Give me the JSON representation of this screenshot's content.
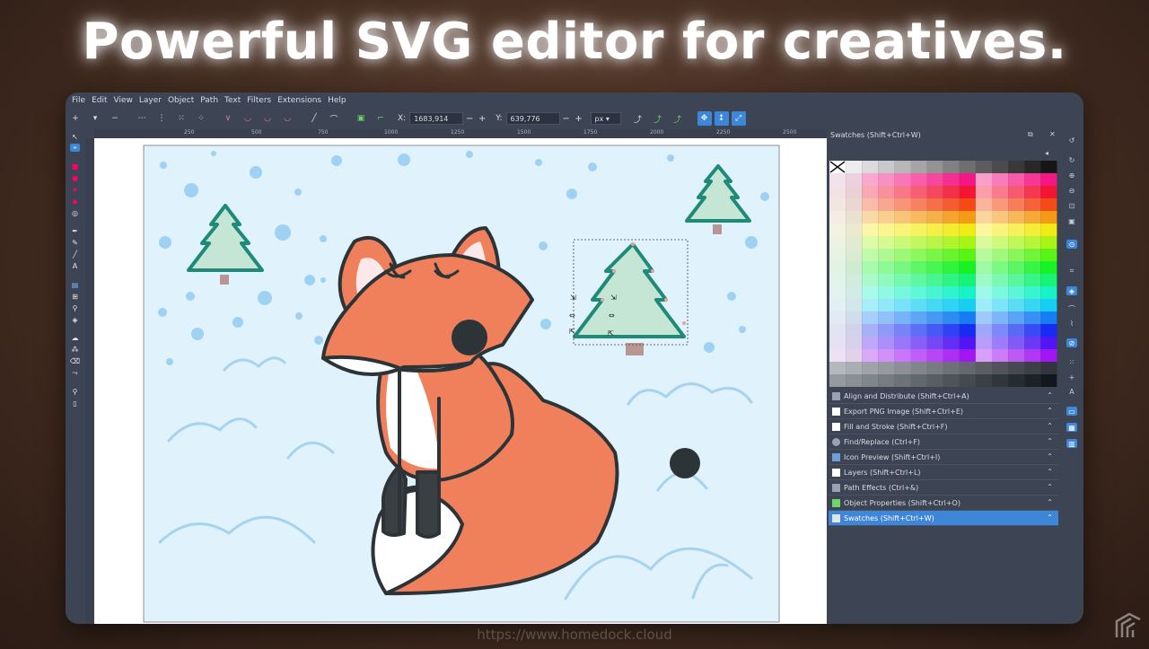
{
  "headline": "Powerful SVG editor for creatives.",
  "footer_url": "https://www.homedock.cloud",
  "colors": {
    "app_bg": "#3d4454",
    "accent": "#3d86d8",
    "canvas_page": "#e0f3fc",
    "fox_orange": "#f07f5c",
    "outline": "#2d3438",
    "tree_fill": "#c5e6d4",
    "tree_stroke": "#1f8a78",
    "snow_dot": "#9fd2f2"
  },
  "menubar": {
    "items": [
      "File",
      "Edit",
      "View",
      "Layer",
      "Object",
      "Path",
      "Text",
      "Filters",
      "Extensions",
      "Help"
    ]
  },
  "toolbar": {
    "x_label": "X:",
    "x_value": "1683,914",
    "y_label": "Y:",
    "y_value": "639,776",
    "minus": "−",
    "plus": "+",
    "unit": "px"
  },
  "ruler": {
    "labels": [
      "250",
      "500",
      "750",
      "1000",
      "1250",
      "1500",
      "1750",
      "2000",
      "2250",
      "2500"
    ]
  },
  "dock": {
    "title": "Swatches (Shift+Ctrl+W)",
    "panels": [
      "Align and Distribute (Shift+Ctrl+A)",
      "Export PNG Image (Shift+Ctrl+E)",
      "Fill and Stroke (Shift+Ctrl+F)",
      "Find/Replace (Ctrl+F)",
      "Icon Preview (Shift+Ctrl+I)",
      "Layers (Shift+Ctrl+L)",
      "Path Effects (Ctrl+&)",
      "Object Properties (Shift+Ctrl+O)",
      "Swatches (Shift+Ctrl+W)"
    ],
    "active_panel": "Swatches (Shift+Ctrl+W)"
  }
}
